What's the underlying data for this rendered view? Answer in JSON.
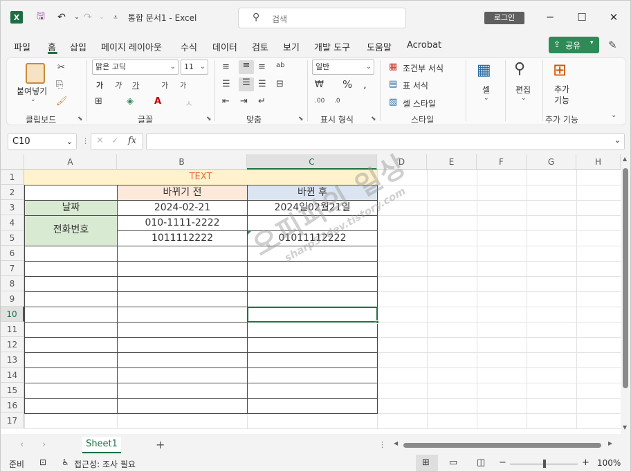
{
  "title_bar": {
    "document_title": "통합 문서1  -  Excel",
    "search_placeholder": "검색",
    "login_label": "로그인",
    "min_glyph": "─",
    "max_glyph": "☐",
    "close_glyph": "✕"
  },
  "ribbon_tabs": [
    "파일",
    "홈",
    "삽입",
    "페이지 레이아웃",
    "수식",
    "데이터",
    "검토",
    "보기",
    "개발 도구",
    "도움말",
    "Acrobat"
  ],
  "share_label": "공유",
  "ribbon": {
    "paste_label": "붙여넣기",
    "font_name": "맑은 고딕",
    "font_size": "11",
    "number_format": "일반",
    "conditional_format": "조건부 서식",
    "table_format": "표 서식",
    "cell_styles": "셀 스타일",
    "cells_label": "셀",
    "editing_label": "편집",
    "addins_label": "추가 기능",
    "addins_label_line1": "추가",
    "addins_label_line2": "기능",
    "groups": [
      "클립보드",
      "글꼴",
      "맞춤",
      "표시 형식",
      "스타일",
      "추가 기능"
    ],
    "font_btns": [
      "가",
      "가",
      "가",
      "가",
      "가"
    ]
  },
  "formula_bar": {
    "name_box": "C10",
    "fx_label": "fx",
    "formula_value": ""
  },
  "grid": {
    "columns": [
      "A",
      "B",
      "C",
      "D",
      "E",
      "F",
      "G",
      "H"
    ],
    "rows": [
      "1",
      "2",
      "3",
      "4",
      "5",
      "6",
      "7",
      "8",
      "9",
      "10",
      "11",
      "12",
      "13",
      "14",
      "15",
      "16",
      "17"
    ],
    "selected_cell": "C10",
    "cells": {
      "A1": "TEXT",
      "B2": "바뀌기 전",
      "C2": "바뀐 후",
      "A3": "날짜",
      "B3": "2024-02-21",
      "C3": "2024일02월21일",
      "A4": "전화번호",
      "B4": "010-1111-2222",
      "B5": "1011112222",
      "C5": "01011112222"
    },
    "fill_colors": {
      "header_orange": "#fde9d9",
      "title_yellow": "#fff2cc",
      "header_blue": "#dbe5f1",
      "label_green": "#d9ead3",
      "title_text": "#e36c46",
      "accent_green": "#1e7145"
    }
  },
  "watermark": {
    "line1": "오피피의 일상",
    "line2": "sharp57dev.tistory.com"
  },
  "sheet_tabs": [
    "Sheet1"
  ],
  "add_sheet": "+",
  "status_bar": {
    "ready": "준비",
    "accessibility": "접근성: 조사 필요",
    "zoom": "100%",
    "zoom_minus": "−",
    "zoom_plus": "+"
  }
}
